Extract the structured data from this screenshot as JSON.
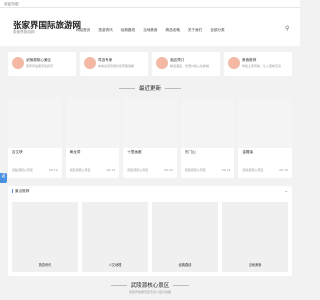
{
  "topbar": {
    "text": "欢迎光临！"
  },
  "site": {
    "title": "张家界国际旅游网",
    "subtitle": "张家界旅游网"
  },
  "nav": [
    "网站首页",
    "旅游资讯",
    "经典路线",
    "当地美食",
    "精品攻略",
    "关于我们",
    "全部分类"
  ],
  "cards": [
    {
      "title": "武陵源核心景区",
      "desc": "张家界最美景色欣赏"
    },
    {
      "title": "导游专家",
      "desc": "本地资深导游为您带路讲解"
    },
    {
      "title": "酒店预订",
      "desc": "精选酒店，优惠价格入住体验"
    },
    {
      "title": "美食推荐",
      "desc": "特色土家风味，让人回味无穷"
    }
  ],
  "latest_title": "最近更新",
  "latest": [
    {
      "title": "百丈峡",
      "category": "武陵源核心景区",
      "date": "06-19"
    },
    {
      "title": "黄龙洞",
      "category": "武陵源核心景区",
      "date": "06-19"
    },
    {
      "title": "十里画廊",
      "category": "武陵源核心景区",
      "date": "06-19"
    },
    {
      "title": "天门山",
      "category": "武陵源核心景区",
      "date": "06-19"
    },
    {
      "title": "金鞭溪",
      "category": "武陵源核心景区",
      "date": "06-19"
    }
  ],
  "side_tag": "返",
  "panel": {
    "title": "景点推荐",
    "chevron": "⌄"
  },
  "categories": [
    "旅游资讯",
    "人文地理",
    "经典路线",
    "当地美食"
  ],
  "bottom": {
    "title": "武陵源核心景区",
    "subtitle": "张家界旅游景区景点介绍与攻略"
  }
}
